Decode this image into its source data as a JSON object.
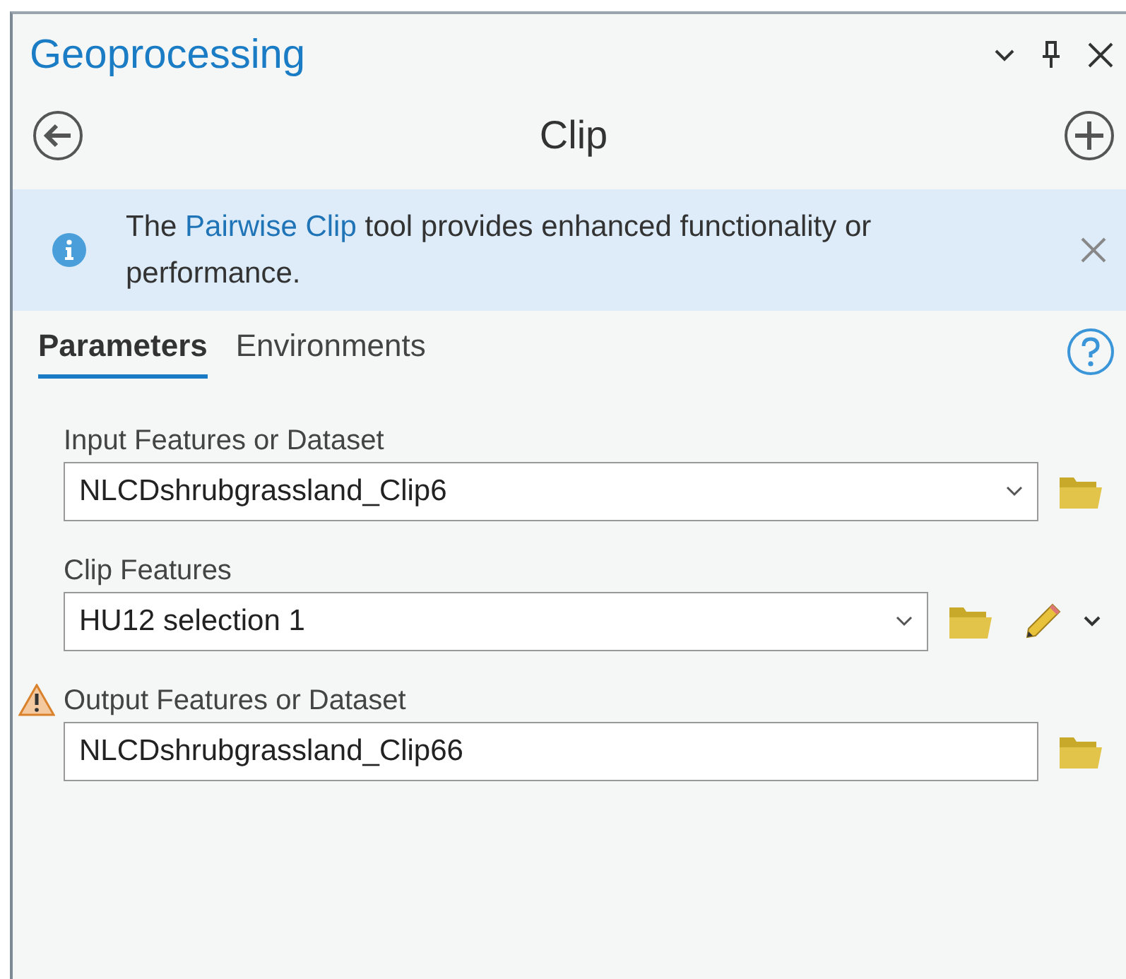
{
  "panel": {
    "title": "Geoprocessing"
  },
  "tool": {
    "title": "Clip"
  },
  "notice": {
    "before": "The ",
    "link": "Pairwise Clip",
    "after": " tool provides enhanced functionality or performance."
  },
  "tabs": [
    {
      "label": "Parameters",
      "selected": true
    },
    {
      "label": "Environments",
      "selected": false
    }
  ],
  "parameters": [
    {
      "label": "Input Features or Dataset",
      "kind": "dropdown",
      "value": "NLCDshrubgrassland_Clip6",
      "warning": false,
      "sketch": false
    },
    {
      "label": "Clip Features",
      "kind": "dropdown",
      "value": "HU12 selection 1",
      "warning": false,
      "sketch": true
    },
    {
      "label": "Output Features or Dataset",
      "kind": "text",
      "value": "NLCDshrubgrassland_Clip66",
      "warning": true,
      "sketch": false
    }
  ]
}
